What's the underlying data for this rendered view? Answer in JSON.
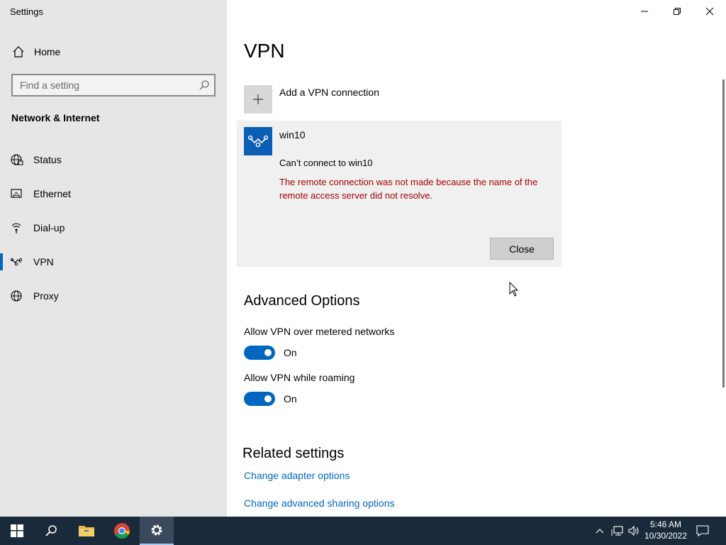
{
  "window": {
    "title": "Settings"
  },
  "sidebar": {
    "home_label": "Home",
    "search_placeholder": "Find a setting",
    "section_title": "Network & Internet",
    "items": [
      {
        "label": "Status",
        "icon": "globe-status-icon"
      },
      {
        "label": "Ethernet",
        "icon": "ethernet-icon"
      },
      {
        "label": "Dial-up",
        "icon": "dialup-icon"
      },
      {
        "label": "VPN",
        "icon": "vpn-icon",
        "active": true
      },
      {
        "label": "Proxy",
        "icon": "globe-icon"
      }
    ]
  },
  "main": {
    "title": "VPN",
    "add_vpn_label": "Add a VPN connection",
    "vpn_connection": {
      "name": "win10",
      "status": "Can’t connect to win10",
      "error": "The remote connection was not made because the name of the remote access server did not resolve.",
      "close_label": "Close"
    },
    "advanced": {
      "title": "Advanced Options",
      "options": [
        {
          "label": "Allow VPN over metered networks",
          "state": "On"
        },
        {
          "label": "Allow VPN while roaming",
          "state": "On"
        }
      ]
    },
    "related": {
      "title": "Related settings",
      "links": [
        "Change adapter options",
        "Change advanced sharing options"
      ]
    }
  },
  "taskbar": {
    "time": "5:46 AM",
    "date": "10/30/2022"
  },
  "colors": {
    "accent": "#0067c0",
    "error": "#a80000",
    "sidebar_bg": "#e6e6e6",
    "taskbar_bg": "#1b2a3b"
  }
}
